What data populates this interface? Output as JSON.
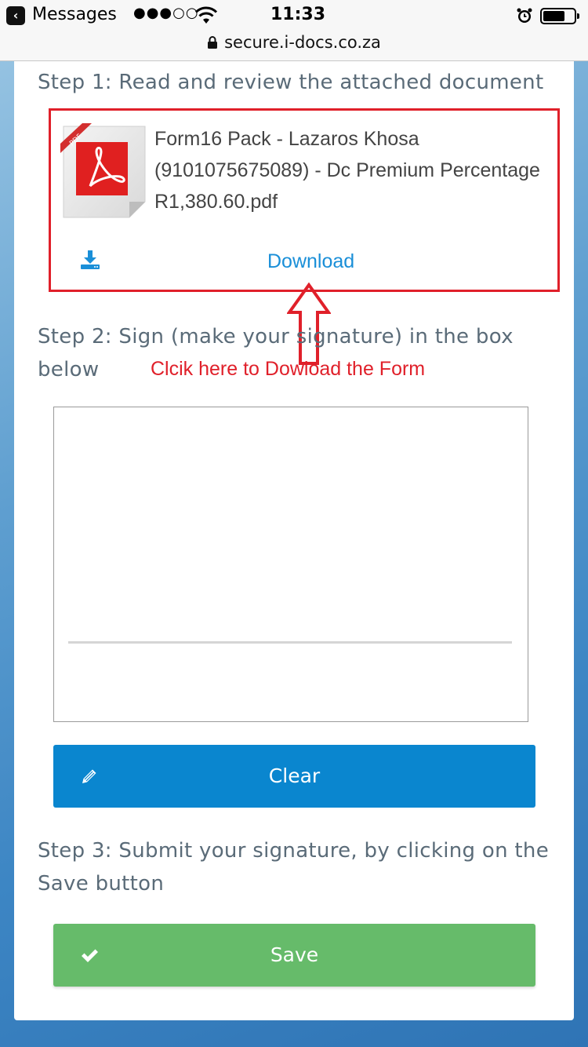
{
  "status_bar": {
    "back_app": "Messages",
    "signal": "●●●○○",
    "time": "11:33"
  },
  "url_bar": {
    "url": "secure.i-docs.co.za"
  },
  "step1": {
    "heading": "Step 1: Read and review the attached document",
    "document_name": "Form16 Pack - Lazaros Khosa (9101075675089) - Dc Premium Percentage R1,380.60.pdf",
    "download_label": "Download"
  },
  "annotation": {
    "text": "Clcik here to Dowload the Form",
    "color": "#e0202a"
  },
  "step2": {
    "heading": "Step 2: Sign (make your signature) in the box below",
    "clear_label": "Clear"
  },
  "step3": {
    "heading": "Step 3: Submit your signature, by clicking on the Save button",
    "save_label": "Save"
  },
  "colors": {
    "primary_button": "#0a86cf",
    "save_button": "#66bb6a",
    "link": "#1a8fd8",
    "highlight": "#e0202a"
  },
  "icons": [
    "back-icon",
    "wifi-icon",
    "alarm-icon",
    "battery-icon",
    "lock-icon",
    "pdf-file-icon",
    "download-icon",
    "pencil-icon",
    "checkmark-icon",
    "up-arrow-annotation"
  ]
}
